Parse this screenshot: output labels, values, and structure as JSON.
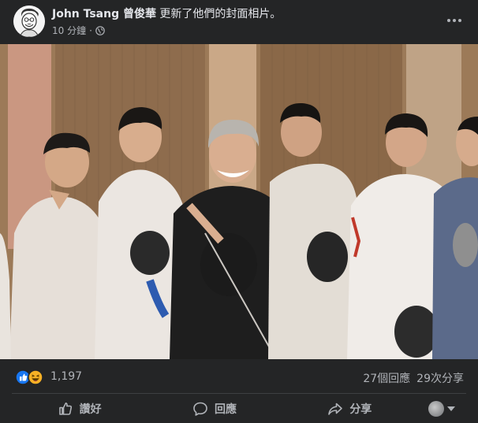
{
  "post": {
    "author": "John Tsang 曾俊華",
    "action": "更新了他們的封面相片。",
    "timestamp": "10 分鐘",
    "separator": "·",
    "audience_icon": "globe-icon",
    "more_icon": "more-options-icon"
  },
  "photo": {
    "description_icon": "cover-photo"
  },
  "reactions": {
    "icons": [
      "like-icon",
      "haha-icon"
    ],
    "count": "1,197",
    "comments": "27個回應",
    "shares": "29次分享"
  },
  "actions": {
    "like_label": "讚好",
    "comment_label": "回應",
    "share_label": "分享"
  },
  "colors": {
    "background": "#242526",
    "text_primary": "#e4e6eb",
    "text_secondary": "#b0b3b8",
    "like_blue": "#1877f2",
    "haha_yellow": "#f7b125"
  }
}
